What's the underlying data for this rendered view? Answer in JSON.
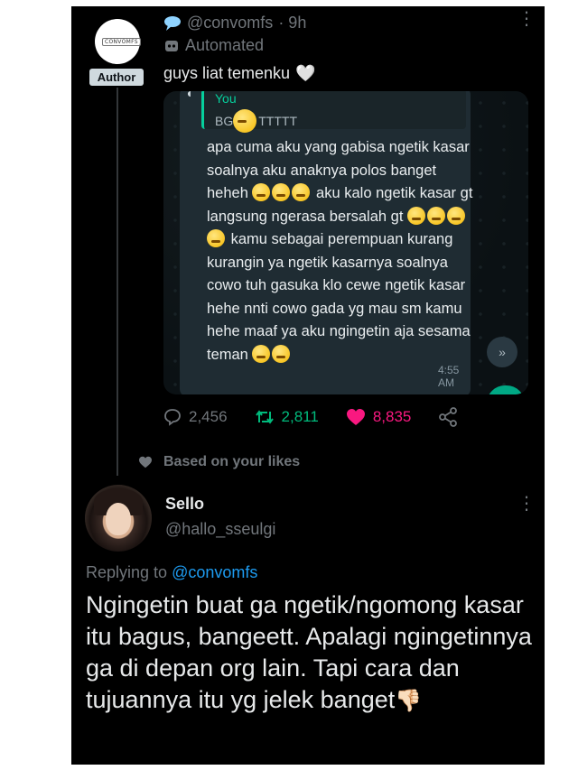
{
  "tweet1": {
    "handle": "@convomfs",
    "time": "· 9h",
    "label": "Automated",
    "badge": "Author",
    "avatar_logo": "CONVOMFS",
    "text": "guys liat temenku",
    "heart": "🤍",
    "image": {
      "quote_name": "You",
      "quote_text_pre": "BG",
      "quote_text_post": "TTTTT",
      "message_parts": [
        "apa cuma aku yang gabisa ngetik kasar soalnya aku anaknya polos banget heheh ",
        " aku kalo ngetik kasar gt langsung ngerasa bersalah gt ",
        " kamu sebagai perempuan kurang kurangin ya ngetik kasarnya soalnya cowo tuh gasuka klo cewe ngetik kasar hehe nnti cowo gada yg mau sm kamu hehe maaf ya aku ngingetin aja sesama teman "
      ],
      "time": "4:55 AM"
    },
    "stats": {
      "replies": "2,456",
      "retweets": "2,811",
      "likes": "8,835"
    }
  },
  "based_label": "Based on your likes",
  "tweet2": {
    "name": "Sello",
    "handle": "@hallo_sseulgi",
    "replying_prefix": "Replying to",
    "replying_handle": "@convomfs",
    "text": "Ngingetin buat ga ngetik/ngomong kasar itu bagus, bangeett. Apalagi ngingetinnya ga di depan org lain. Tapi cara dan tujuannya itu yg jelek banget",
    "emoji": "👎🏻"
  },
  "colors": {
    "background": "#000000",
    "muted": "#71767b",
    "link": "#1d9bf0",
    "retweet": "#00ba7c",
    "like": "#f91880"
  }
}
